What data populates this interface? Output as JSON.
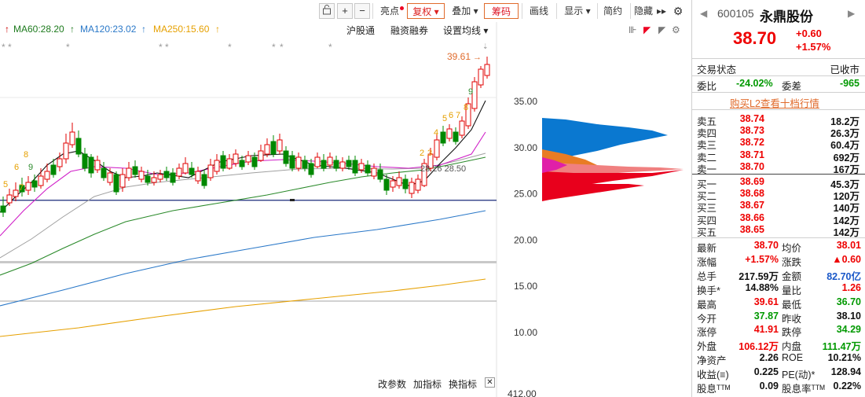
{
  "toolbar": {
    "lock_icon": "lock-icon",
    "plus": "+",
    "minus": "−",
    "highlight": "亮点",
    "restore_rights": "复权",
    "overlay": "叠加",
    "chips": "筹码",
    "draw_line": "画线",
    "display": "显示",
    "simple": "简约",
    "hide": "隐藏",
    "expand": "▸▸",
    "dropdown": "▾"
  },
  "ma_legend": {
    "ma60": "MA60:28.20",
    "ma120": "MA120:23.02",
    "ma250": "MA250:15.60",
    "arrow_up": "↑"
  },
  "sub_links": {
    "hgt": "沪股通",
    "margin": "融资融券",
    "set_ma": "设置均线"
  },
  "chart": {
    "price_labels": [
      "35.00",
      "30.00",
      "25.00",
      "20.00",
      "15.00",
      "10.00"
    ],
    "bottom_price": "412.00",
    "high_label": "39.61",
    "ma_label": "28.26 28.50",
    "seq_numbers": [
      "5",
      "6",
      "7",
      "8",
      "9",
      "2",
      "3",
      "4",
      "5",
      "6",
      "7",
      "8",
      "9"
    ],
    "stars": "*"
  },
  "chart_data": {
    "type": "candlestick",
    "high_marker": 39.61,
    "levels": {
      "blue_line": 24.3
    },
    "ylim": [
      9.5,
      41
    ],
    "ma_values": {
      "MA60": 28.2,
      "MA120": 23.02,
      "MA250": 15.6
    },
    "chip_peak_price": 27.5
  },
  "bottom_tools": {
    "params": "改参数",
    "add_indicator": "加指标",
    "replace_indicator": "换指标",
    "close": "✕"
  },
  "panel": {
    "code": "600105",
    "name": "永鼎股份",
    "price": "38.70",
    "change": "+0.60",
    "change_pct": "+1.57%",
    "trade_status_label": "交易状态",
    "trade_status": "已收市",
    "wb_label": "委比",
    "wb_value": "-24.02%",
    "wc_label": "委差",
    "wc_value": "-965",
    "buy_l2": "购买L2查看十档行情",
    "sells": [
      {
        "label": "卖五",
        "price": "38.74",
        "vol": "18.2万"
      },
      {
        "label": "卖四",
        "price": "38.73",
        "vol": "26.3万"
      },
      {
        "label": "卖三",
        "price": "38.72",
        "vol": "60.4万"
      },
      {
        "label": "卖二",
        "price": "38.71",
        "vol": "692万"
      },
      {
        "label": "卖一",
        "price": "38.70",
        "vol": "167万"
      }
    ],
    "buys": [
      {
        "label": "买一",
        "price": "38.69",
        "vol": "45.3万"
      },
      {
        "label": "买二",
        "price": "38.68",
        "vol": "120万"
      },
      {
        "label": "买三",
        "price": "38.67",
        "vol": "140万"
      },
      {
        "label": "买四",
        "price": "38.66",
        "vol": "142万"
      },
      {
        "label": "买五",
        "price": "38.65",
        "vol": "142万"
      }
    ],
    "stats": [
      {
        "l1": "最新",
        "v1": "38.70",
        "c1": "red",
        "l2": "均价",
        "v2": "38.01",
        "c2": "red"
      },
      {
        "l1": "涨幅",
        "v1": "+1.57%",
        "c1": "red",
        "l2": "涨跌",
        "v2": "▲0.60",
        "c2": "red"
      },
      {
        "l1": "总手",
        "v1": "217.59万",
        "c1": "blk",
        "l2": "金额",
        "v2": "82.70亿",
        "c2": "blue"
      },
      {
        "l1": "换手*",
        "v1": "14.88%",
        "c1": "blk",
        "l2": "量比",
        "v2": "1.26",
        "c2": "red"
      },
      {
        "l1": "最高",
        "v1": "39.61",
        "c1": "red",
        "l2": "最低",
        "v2": "36.70",
        "c2": "green"
      },
      {
        "l1": "今开",
        "v1": "37.87",
        "c1": "green",
        "l2": "昨收",
        "v2": "38.10",
        "c2": "blk"
      },
      {
        "l1": "涨停",
        "v1": "41.91",
        "c1": "red",
        "l2": "跌停",
        "v2": "34.29",
        "c2": "green"
      },
      {
        "l1": "外盘",
        "v1": "106.12万",
        "c1": "red",
        "l2": "内盘",
        "v2": "111.47万",
        "c2": "green"
      },
      {
        "l1": "净资产",
        "v1": "2.26",
        "c1": "blk",
        "l2": "ROE",
        "v2": "10.21%",
        "c2": "blk"
      },
      {
        "l1": "收益(≡)",
        "v1": "0.225",
        "c1": "blk",
        "l2": "PE(动)*",
        "v2": "128.94",
        "c2": "blk"
      },
      {
        "l1": "股息ᵀᵀᴹ",
        "v1": "0.09",
        "c1": "blk",
        "l2": "股息率ᵀᵀᴹ",
        "v2": "0.22%",
        "c2": "blk"
      }
    ],
    "nav_left": "◀",
    "nav_right": "▶"
  },
  "colors": {
    "up": "#e00000",
    "down": "#009000",
    "accent": "#e06b2c",
    "blue": "#1a58c8"
  }
}
